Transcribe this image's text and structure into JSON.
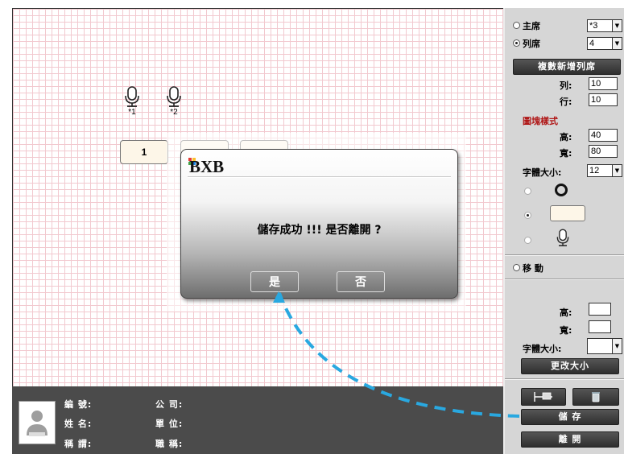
{
  "canvas": {
    "microphones": [
      {
        "label": "*1"
      },
      {
        "label": "*2"
      }
    ],
    "seat_boxes": [
      {
        "label": "1"
      },
      {
        "label": ""
      },
      {
        "label": ""
      }
    ]
  },
  "dialog": {
    "logo_text": "BXB",
    "message": "儲存成功 !!! 是否離開 ?",
    "yes_label": "是",
    "no_label": "否"
  },
  "info_bar": {
    "number_label": "編 號:",
    "name_label": "姓 名:",
    "title_label": "稱 謂:",
    "company_label": "公 司:",
    "unit_label": "單 位:",
    "position_label": "職 稱:"
  },
  "panel": {
    "chair_label": "主席",
    "chair_value": "*3",
    "row_seat_label": "列席",
    "row_seat_value": "4",
    "add_row_button": "複數新增列席",
    "columns_label": "列:",
    "columns_value": "10",
    "rows_label": "行:",
    "rows_value": "10",
    "block_style_label": "圖塊樣式",
    "height_label": "高:",
    "height_value": "40",
    "width_label": "寬:",
    "width_value": "80",
    "font_size_label": "字體大小:",
    "font_size_value": "12",
    "move_label": "移 動",
    "resize_height_label": "高:",
    "resize_width_label": "寬:",
    "resize_font_label": "字體大小:",
    "resize_button": "更改大小",
    "save_button": "儲 存",
    "leave_button": "離 開",
    "accent_color": "#b01818",
    "annotation_color": "#29a8e0"
  }
}
